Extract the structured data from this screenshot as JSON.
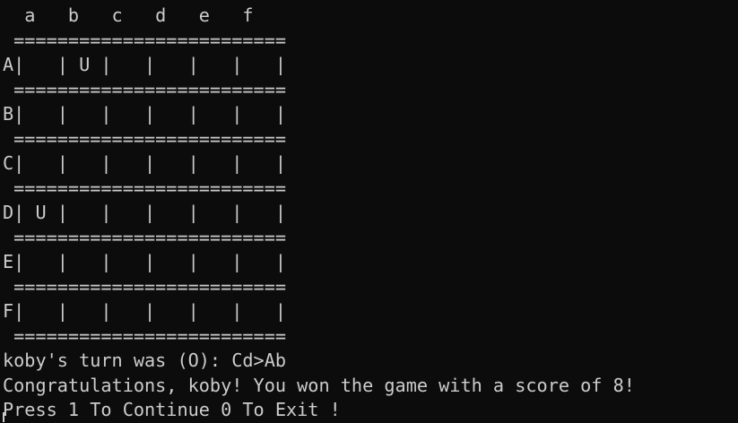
{
  "terminal": {
    "header": "  a   b   c   d   e   f",
    "separator": " =========================",
    "board_rows": [
      "A|   | U |   |   |   |   |",
      "B|   |   |   |   |   |   |",
      "C|   |   |   |   |   |   |",
      "D| U |   |   |   |   |   |",
      "E|   |   |   |   |   |   |",
      "F|   |   |   |   |   |   |"
    ],
    "turn_message": "koby's turn was (O): Cd>Ab",
    "win_message": "Congratulations, koby! You won the game with a score of 8!",
    "prompt_message": "Press 1 To Continue 0 To Exit !"
  }
}
